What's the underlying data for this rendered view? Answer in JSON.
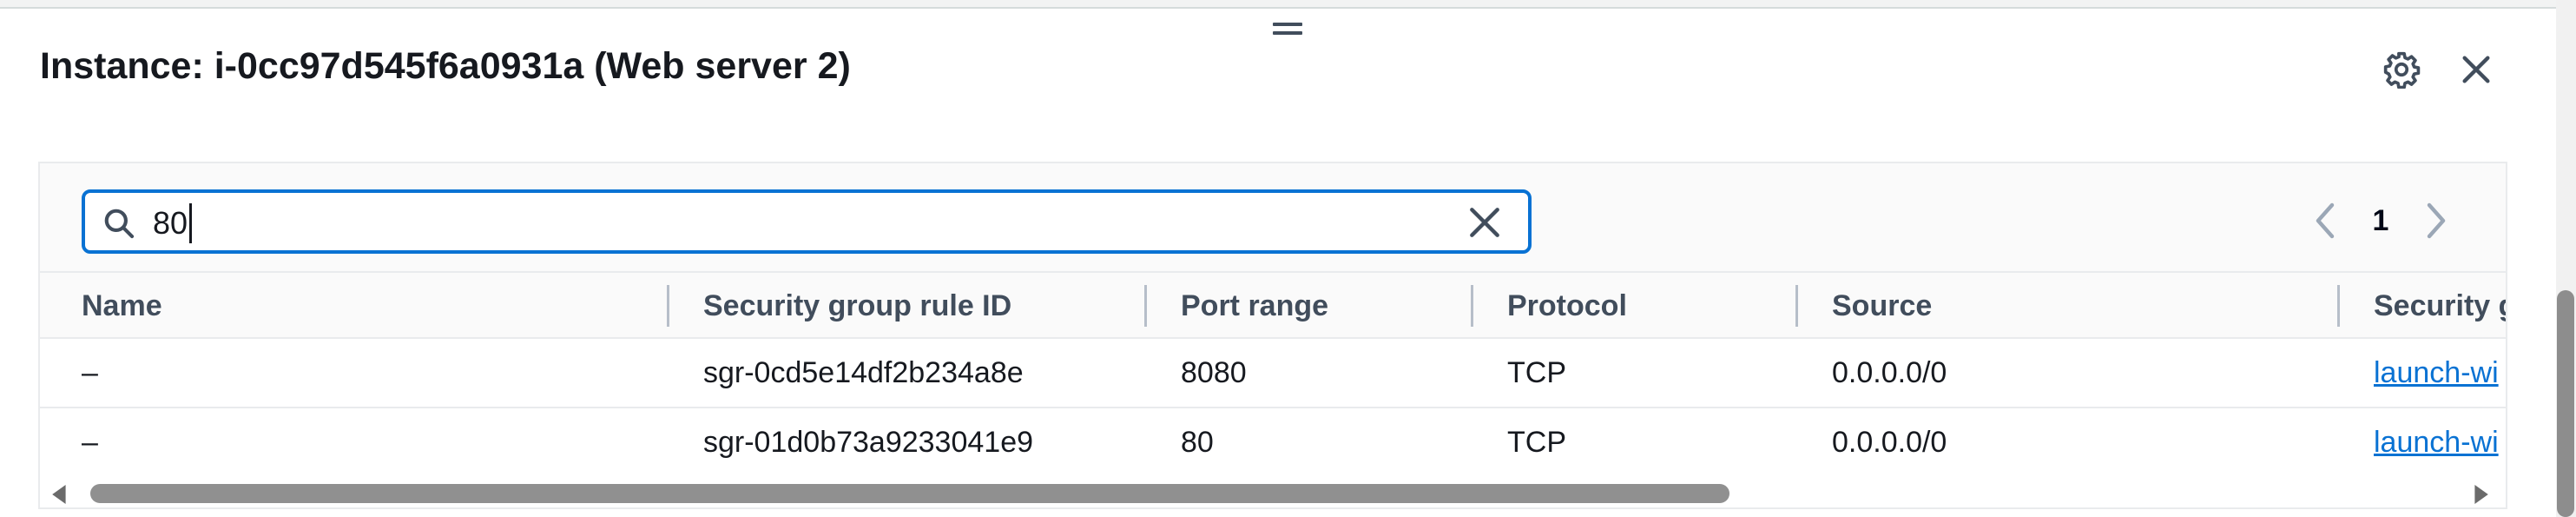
{
  "panel": {
    "title": "Instance: i-0cc97d545f6a0931a (Web server 2)",
    "icons": {
      "settings": "gear-icon",
      "close": "close-icon",
      "drag": "drag-handle-icon"
    }
  },
  "search": {
    "value": "80",
    "icon": "search-icon",
    "clear_icon": "clear-icon"
  },
  "pagination": {
    "current_page": "1",
    "prev_icon": "chevron-left-icon",
    "next_icon": "chevron-right-icon"
  },
  "table": {
    "columns": [
      "Name",
      "Security group rule ID",
      "Port range",
      "Protocol",
      "Source",
      "Security g"
    ],
    "rows": [
      {
        "name": "–",
        "rule_id": "sgr-0cd5e14df2b234a8e",
        "port_range": "8080",
        "protocol": "TCP",
        "source": "0.0.0.0/0",
        "security_group": "launch-wi"
      },
      {
        "name": "–",
        "rule_id": "sgr-01d0b73a9233041e9",
        "port_range": "80",
        "protocol": "TCP",
        "source": "0.0.0.0/0",
        "security_group": "launch-wi"
      }
    ]
  },
  "colors": {
    "accent": "#0972d3",
    "text": "#16191f",
    "header_text": "#414d5c",
    "border": "#e9ebed"
  }
}
